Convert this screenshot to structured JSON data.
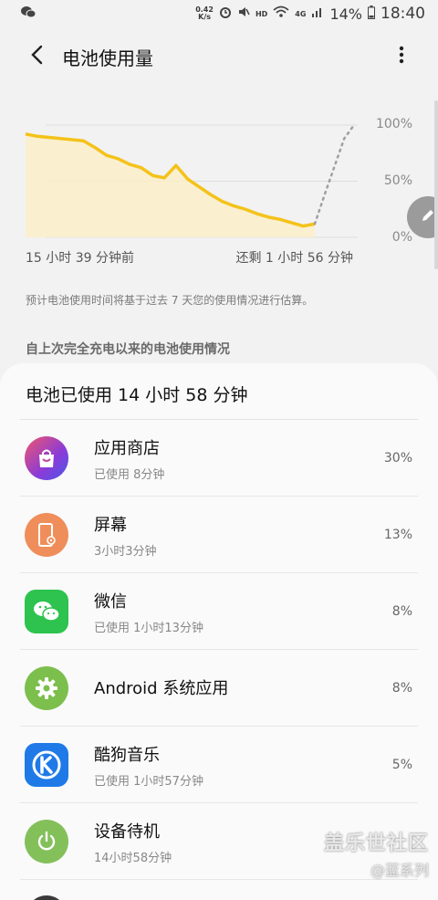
{
  "status_bar": {
    "net_speed_value": "0.42",
    "net_speed_unit": "K/s",
    "hd_label": "HD",
    "signal_label": "4G",
    "battery_percent": "14%",
    "time": "18:40"
  },
  "header": {
    "title": "电池使用量"
  },
  "chart_data": {
    "type": "line",
    "y_tick_labels": [
      "100%",
      "50%",
      "0%"
    ],
    "ylim": [
      0,
      100
    ],
    "x_start_label": "15 小时 39 分钟前",
    "x_end_label": "还剩 1 小时 56 分钟",
    "series": [
      {
        "values": [
          92,
          90,
          89,
          88,
          87,
          86,
          80,
          73,
          70,
          65,
          62,
          55,
          53,
          64,
          52,
          45,
          38,
          32,
          28,
          25,
          21,
          18,
          16,
          13,
          10,
          12
        ]
      },
      {
        "style": "dotted-prediction",
        "values": [
          12,
          38,
          63,
          88,
          100
        ]
      }
    ],
    "line_color": "#f4c21a",
    "fill_color": "#fbefc7",
    "prediction_color": "#a0a0a0"
  },
  "hint_text": "预计电池使用时间将基于过去 7 天您的使用情况进行估算。",
  "section_title": "自上次完全充电以来的电池使用情况",
  "card": {
    "title": "电池已使用 14 小时 58 分钟",
    "apps": [
      {
        "name": "应用商店",
        "sub": "已使用 8分钟",
        "pct": "30%",
        "icon": "shopping-bag-icon",
        "color": "#a43aa0"
      },
      {
        "name": "屏幕",
        "sub": "3小时3分钟",
        "pct": "13%",
        "icon": "screen-icon",
        "color": "#ef8e5a"
      },
      {
        "name": "微信",
        "sub": "已使用 1小时13分钟",
        "pct": "8%",
        "icon": "wechat-icon",
        "color": "#2dc34e"
      },
      {
        "name": "Android 系统应用",
        "sub": "",
        "pct": "8%",
        "icon": "gear-icon",
        "color": "#7cbf4c"
      },
      {
        "name": "酷狗音乐",
        "sub": "已使用 1小时57分钟",
        "pct": "5%",
        "icon": "kugou-icon",
        "color": "#1f7ae8"
      },
      {
        "name": "设备待机",
        "sub": "14小时58分钟",
        "pct": "",
        "icon": "power-icon",
        "color": "#83c05a"
      }
    ]
  },
  "watermark": {
    "main": "盖乐世社区",
    "sub": "@蓝系列"
  }
}
